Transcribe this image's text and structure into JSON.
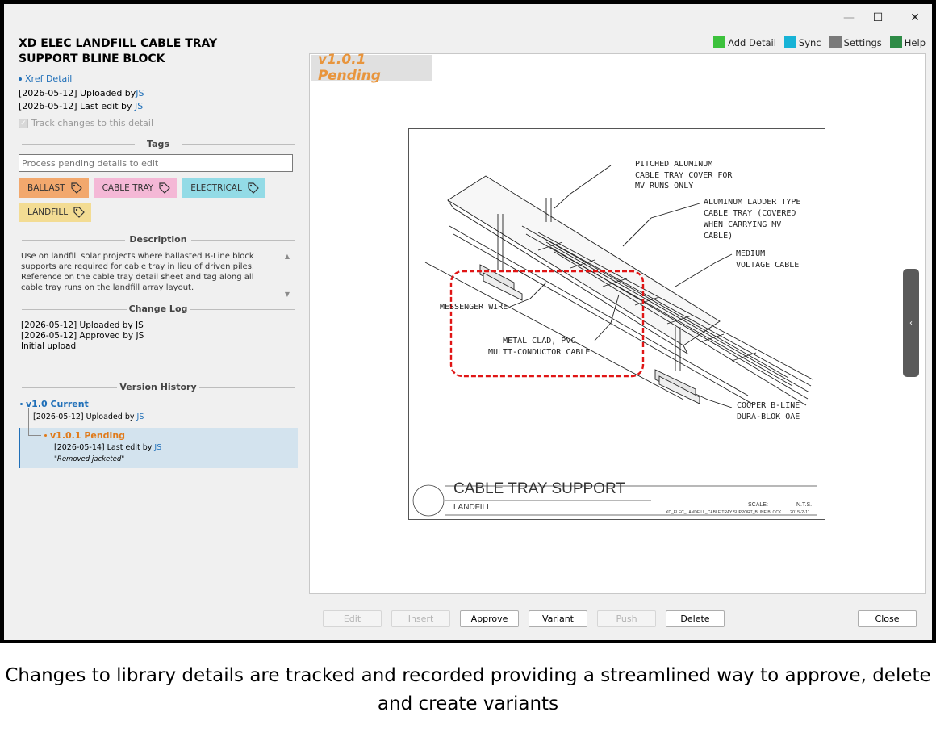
{
  "window": {
    "minimize_glyph": "—",
    "maximize_glyph": "☐",
    "close_glyph": "✕"
  },
  "detail": {
    "title": "XD ELEC LANDFILL CABLE TRAY SUPPORT BLINE BLOCK",
    "xref_label": "Xref Detail",
    "uploaded_prefix": "[2026-05-12] Uploaded by",
    "uploaded_user": "JS",
    "last_edit_prefix": "[2026-05-12] Last edit by",
    "last_edit_user": "JS",
    "track_changes_label": "Track changes to this detail",
    "track_changes_checked": true
  },
  "tags": {
    "section_title": "Tags",
    "placeholder": "Process pending details to edit",
    "items": [
      {
        "label": "BALLAST",
        "color": "#f2a86d"
      },
      {
        "label": "CABLE TRAY",
        "color": "#f4b8d6"
      },
      {
        "label": "ELECTRICAL",
        "color": "#93dbe6"
      },
      {
        "label": "LANDFILL",
        "color": "#f3dc93"
      }
    ]
  },
  "description": {
    "section_title": "Description",
    "text": "Use on landfill solar projects where ballasted B-Line block supports are required for cable tray in lieu of driven piles. Reference on the cable tray detail sheet and tag along all cable tray runs on the landfill array layout."
  },
  "change_log": {
    "section_title": "Change Log",
    "entries": [
      "[2026-05-12] Uploaded by JS",
      "[2026-05-12] Approved by JS",
      "Initial upload"
    ]
  },
  "version_history": {
    "section_title": "Version History",
    "current": {
      "label": "v1.0 Current",
      "meta_prefix": "[2026-05-12] Uploaded by",
      "user": "JS"
    },
    "pending": {
      "label": "v1.0.1 Pending",
      "meta_prefix": "[2026-05-14] Last edit by",
      "user": "JS",
      "note": "\"Removed jacketed\""
    }
  },
  "top_actions": [
    {
      "label": "Add Detail",
      "color": "#3cc23c",
      "icon": "add-detail-swatch"
    },
    {
      "label": "Sync",
      "color": "#17b3d6",
      "icon": "sync-swatch"
    },
    {
      "label": "Settings",
      "color": "#7a7a7a",
      "icon": "settings-swatch"
    },
    {
      "label": "Help",
      "color": "#2e8b46",
      "icon": "help-swatch"
    }
  ],
  "preview": {
    "version_badge": "v1.0.1 Pending",
    "drawing": {
      "callouts": [
        [
          "PITCHED ALUMINUM",
          "CABLE TRAY COVER FOR",
          "MV RUNS ONLY"
        ],
        [
          "ALUMINUM LADDER TYPE",
          "CABLE TRAY (COVERED",
          "WHEN CARRYING MV",
          "CABLE)"
        ],
        [
          "MEDIUM",
          "VOLTAGE CABLE"
        ],
        [
          "MESSENGER WIRE"
        ],
        [
          "METAL CLAD, PVC",
          "MULTI-CONDUCTOR CABLE"
        ],
        [
          "COOPER B-LINE",
          "DURA-BLOK OAE"
        ]
      ],
      "title": "CABLE TRAY SUPPORT",
      "subtitle": "LANDFILL",
      "scale_label": "SCALE:",
      "scale_value": "N.T.S.",
      "filename": "XD_ELEC_LANDFILL_CABLE TRAY SUPPORT_BLINE BLOCK",
      "date": "2015-2-11"
    },
    "collapse_glyph": "‹"
  },
  "buttons": {
    "edit": "Edit",
    "insert": "Insert",
    "approve": "Approve",
    "variant": "Variant",
    "push": "Push",
    "delete": "Delete",
    "close": "Close"
  },
  "caption": "Changes to library details are tracked and recorded providing a streamlined way to approve, delete and create variants"
}
